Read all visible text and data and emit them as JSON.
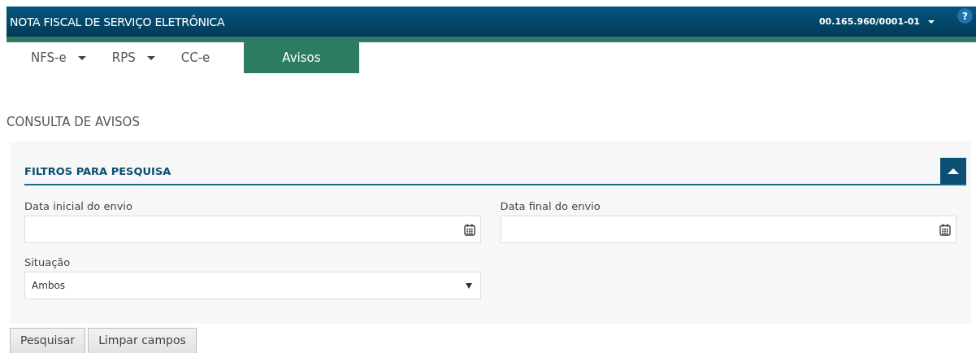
{
  "header": {
    "title": "NOTA FISCAL DE SERVIÇO ELETRÔNICA",
    "account": "00.165.960/0001-01",
    "help": "?"
  },
  "nav": [
    {
      "label": "NFS-e",
      "has_menu": true,
      "selected": false
    },
    {
      "label": "RPS",
      "has_menu": true,
      "selected": false
    },
    {
      "label": "CC-e",
      "has_menu": false,
      "selected": false
    },
    {
      "label": "Avisos",
      "has_menu": false,
      "selected": true
    }
  ],
  "page_title": "CONSULTA DE AVISOS",
  "filters": {
    "title": "FILTROS PARA PESQUISA",
    "expanded": true,
    "fields": [
      {
        "label": "Data inicial do envio",
        "kind": "date"
      },
      {
        "label": "Data final do envio",
        "kind": "date"
      },
      {
        "label": "Situação",
        "kind": "select",
        "value": "Ambos"
      }
    ]
  },
  "buttons": [
    "Pesquisar",
    "Limpar campos"
  ]
}
